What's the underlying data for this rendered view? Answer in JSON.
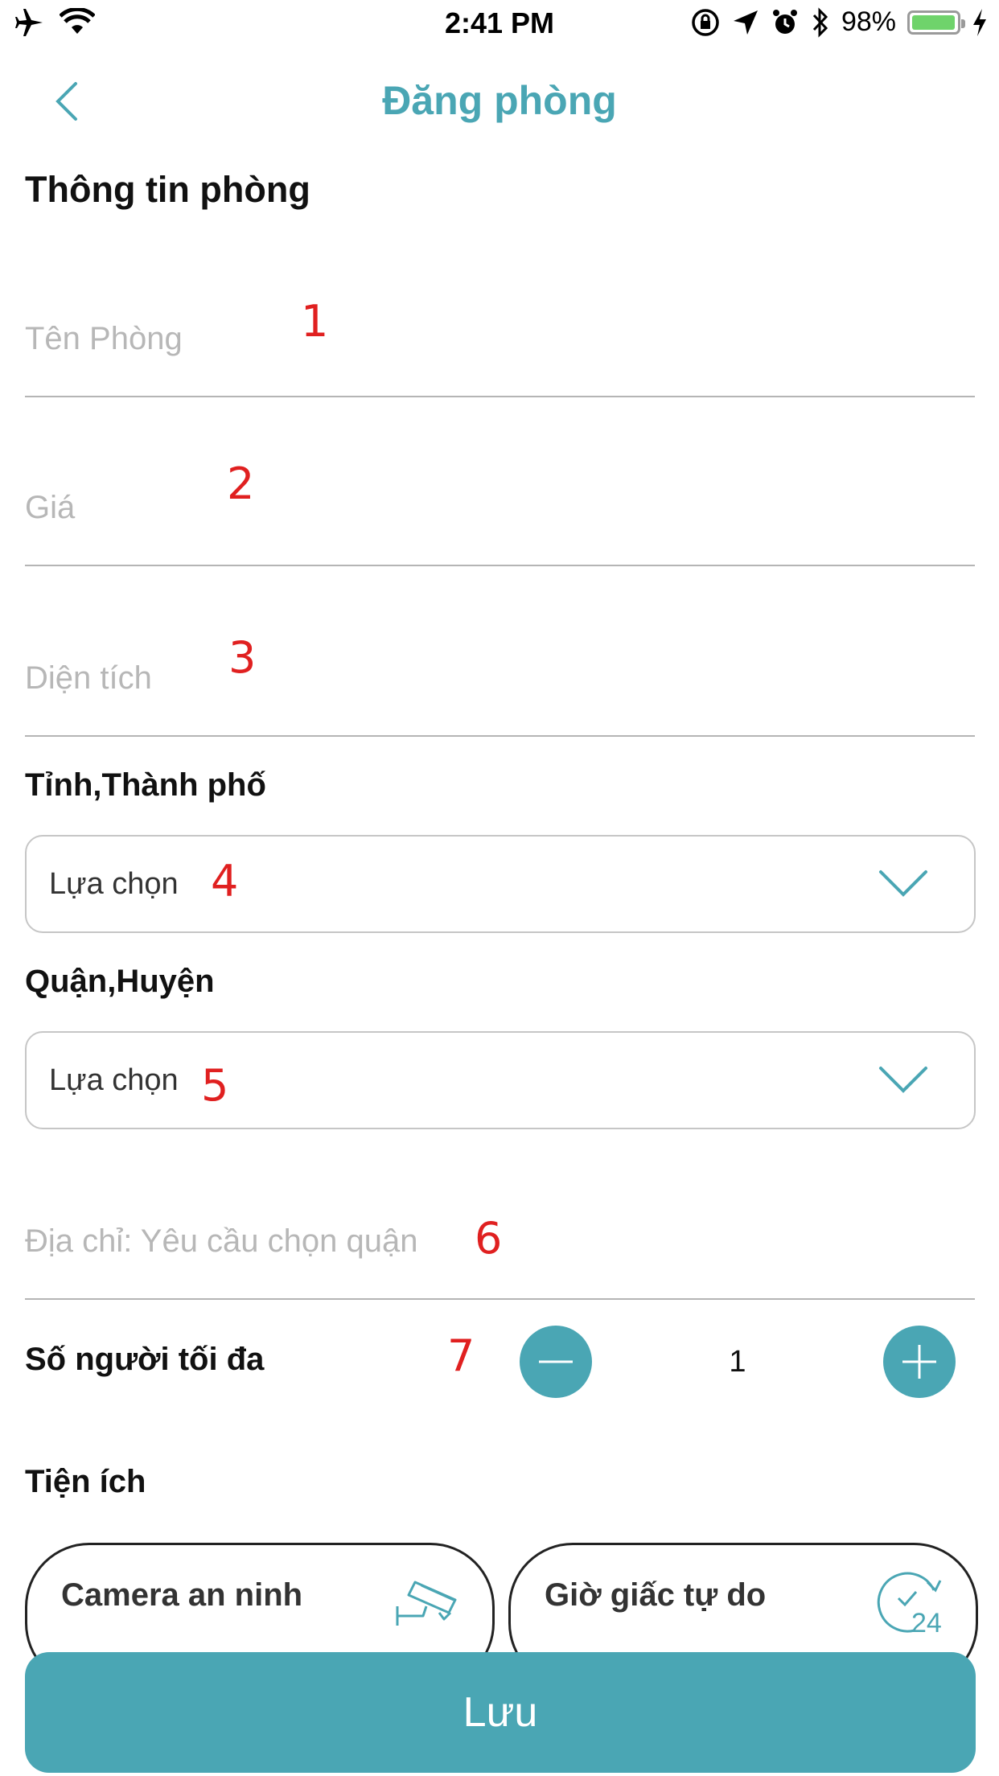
{
  "status_bar": {
    "time": "2:41 PM",
    "battery_percent": "98%",
    "battery_level": 0.98
  },
  "nav": {
    "title": "Đăng phòng",
    "back_icon": "chevron-left-icon"
  },
  "section": {
    "title": "Thông tin phòng"
  },
  "fields": {
    "room_name_placeholder": "Tên Phòng",
    "price_placeholder": "Giá",
    "area_placeholder": "Diện tích",
    "address_placeholder": "Địa chỉ: Yêu cầu chọn quận"
  },
  "province": {
    "label": "Tỉnh,Thành phố",
    "selected": "Lựa chọn"
  },
  "district": {
    "label": "Quận,Huyện",
    "selected": "Lựa chọn"
  },
  "max_people": {
    "label": "Số người tối đa",
    "value": "1"
  },
  "amenities": {
    "label": "Tiện ích",
    "items": [
      {
        "label": "Camera an ninh",
        "icon": "security-camera-icon"
      },
      {
        "label": "Giờ giấc tự do",
        "icon": "clock-24-icon",
        "icon_text": "24"
      }
    ]
  },
  "save_label": "Lưu",
  "annotations": [
    "1",
    "2",
    "3",
    "4",
    "5",
    "6",
    "7"
  ],
  "colors": {
    "accent": "#4aa6b4",
    "annotation": "#e02020"
  }
}
